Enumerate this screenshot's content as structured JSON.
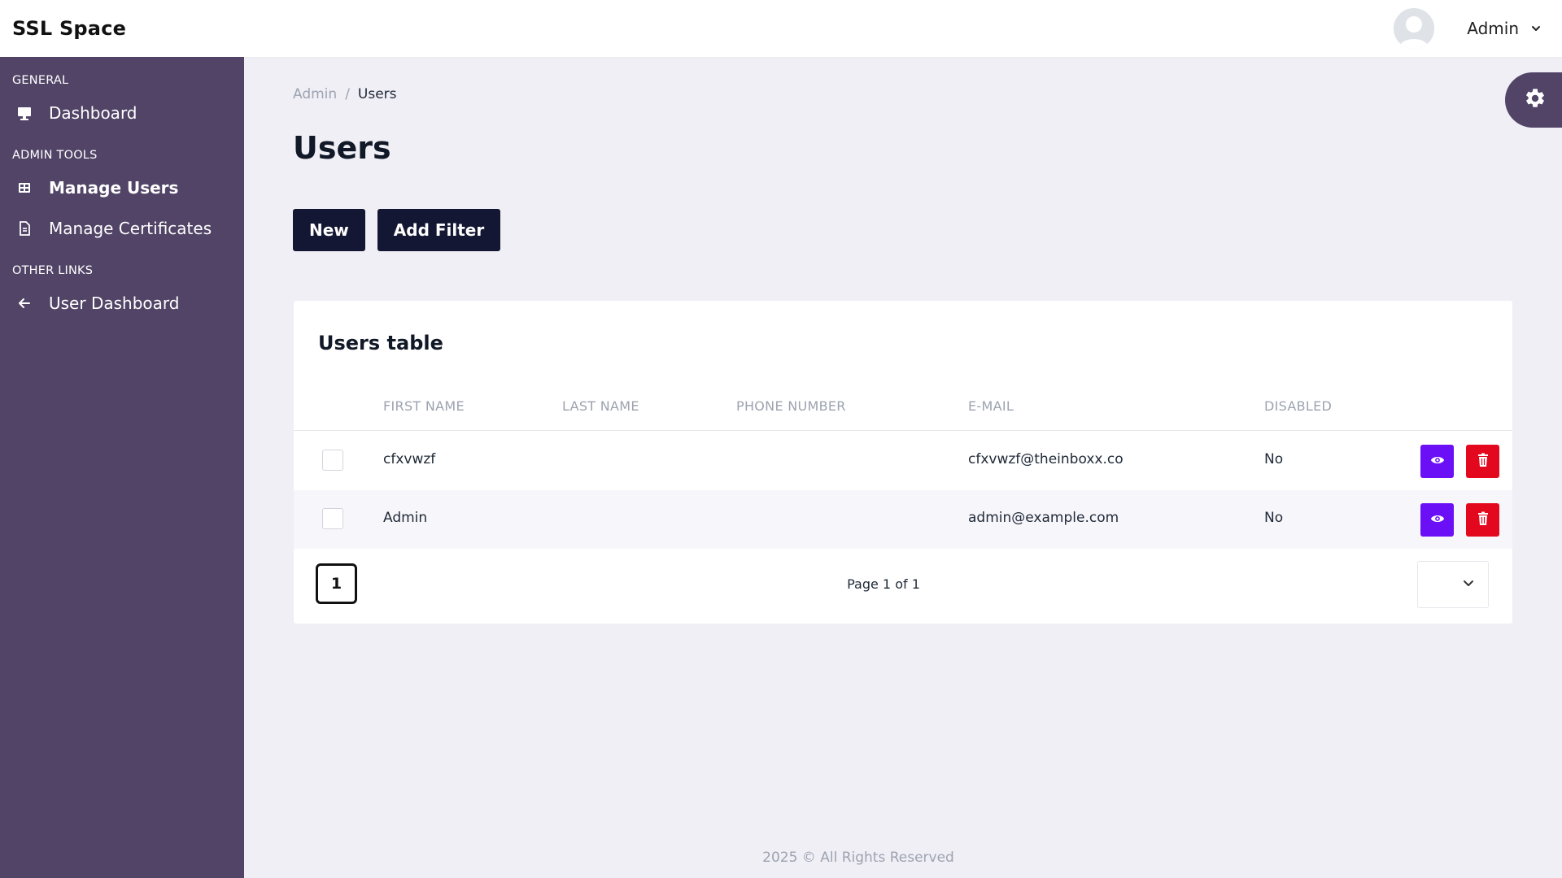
{
  "app": {
    "brand": "SSL Space"
  },
  "header": {
    "user_name": "Admin"
  },
  "sidebar": {
    "sections": [
      {
        "label": "GENERAL",
        "items": [
          {
            "label": "Dashboard",
            "icon": "monitor-icon"
          }
        ]
      },
      {
        "label": "ADMIN TOOLS",
        "items": [
          {
            "label": "Manage Users",
            "icon": "table-icon",
            "active": true
          },
          {
            "label": "Manage Certificates",
            "icon": "document-icon"
          }
        ]
      },
      {
        "label": "OTHER LINKS",
        "items": [
          {
            "label": "User Dashboard",
            "icon": "arrow-left-icon"
          }
        ]
      }
    ]
  },
  "breadcrumb": {
    "parent": "Admin",
    "separator": "/",
    "current": "Users"
  },
  "page": {
    "title": "Users"
  },
  "actions": {
    "new_label": "New",
    "filter_label": "Add Filter"
  },
  "table": {
    "title": "Users table",
    "columns": [
      "FIRST NAME",
      "LAST NAME",
      "PHONE NUMBER",
      "E-MAIL",
      "DISABLED"
    ],
    "rows": [
      {
        "first_name": "cfxvwzf",
        "last_name": "",
        "phone": "",
        "email": "cfxvwzf@theinboxx.co",
        "disabled": "No"
      },
      {
        "first_name": "Admin",
        "last_name": "",
        "phone": "",
        "email": "admin@example.com",
        "disabled": "No"
      }
    ]
  },
  "pagination": {
    "current_page": "1",
    "info": "Page 1 of 1"
  },
  "footer": {
    "text": "2025 © All Rights Reserved"
  },
  "colors": {
    "sidebar": "#514466",
    "button": "#141733",
    "view": "#6b0ff7",
    "delete": "#e3081e"
  }
}
